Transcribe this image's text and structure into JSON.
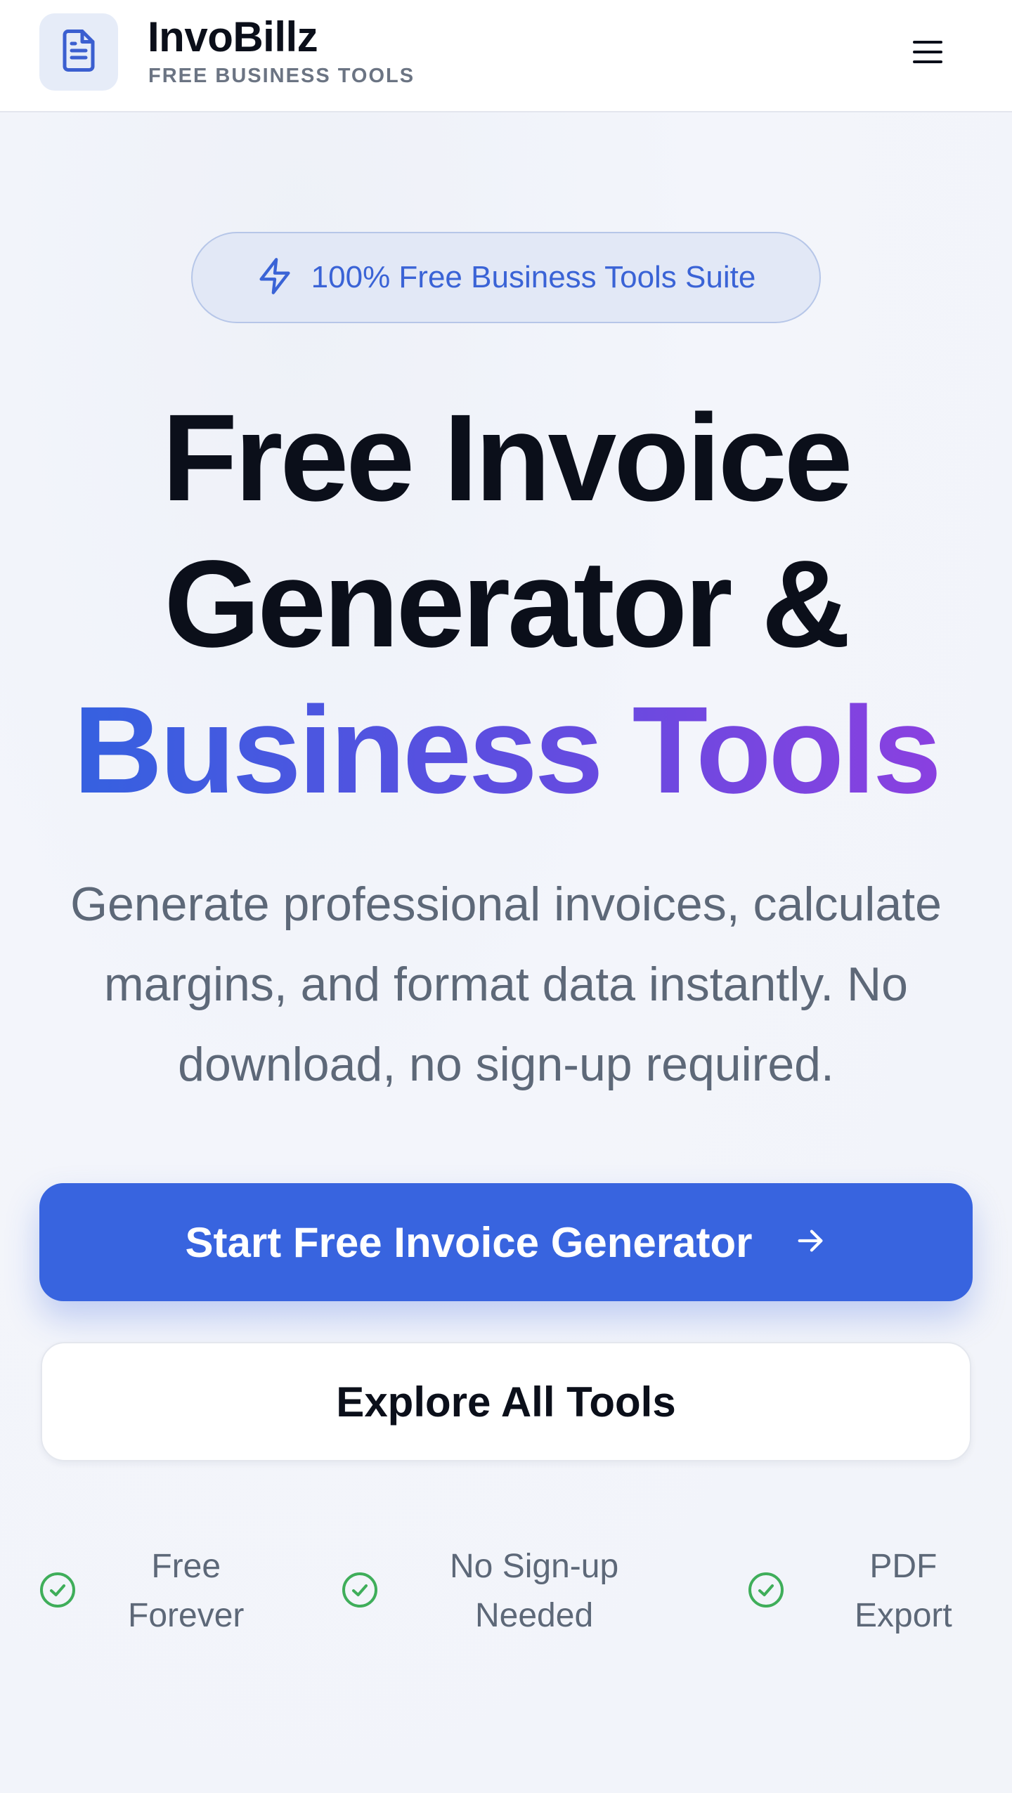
{
  "header": {
    "brand_name": "InvoBillz",
    "brand_tagline": "FREE BUSINESS TOOLS",
    "logo_icon": "document-icon",
    "menu_icon": "hamburger-menu-icon"
  },
  "hero": {
    "badge": {
      "icon": "lightning-bolt-icon",
      "text": "100% Free Business Tools Suite"
    },
    "headline_line1": "Free Invoice",
    "headline_line2": "Generator &",
    "headline_line3": "Business Tools",
    "subtitle_line1": "Generate professional invoices, calculate",
    "subtitle_line2": "margins, and format data instantly. No",
    "subtitle_line3": "download, no sign-up required.",
    "primary_button": {
      "label": "Start Free Invoice Generator",
      "icon": "arrow-right-icon"
    },
    "secondary_button": {
      "label": "Explore All Tools"
    },
    "features": [
      {
        "icon": "check-circle-icon",
        "line1": "Free",
        "line2": "Forever"
      },
      {
        "icon": "check-circle-icon",
        "line1": "No Sign-up",
        "line2": "Needed"
      },
      {
        "icon": "check-circle-icon",
        "line1": "PDF",
        "line2": "Export"
      }
    ]
  },
  "colors": {
    "accent": "#3864df",
    "gradient_start": "#3561e0",
    "gradient_end": "#8a40e0",
    "check_green": "#3fae5a",
    "text_muted": "#5d6878"
  }
}
